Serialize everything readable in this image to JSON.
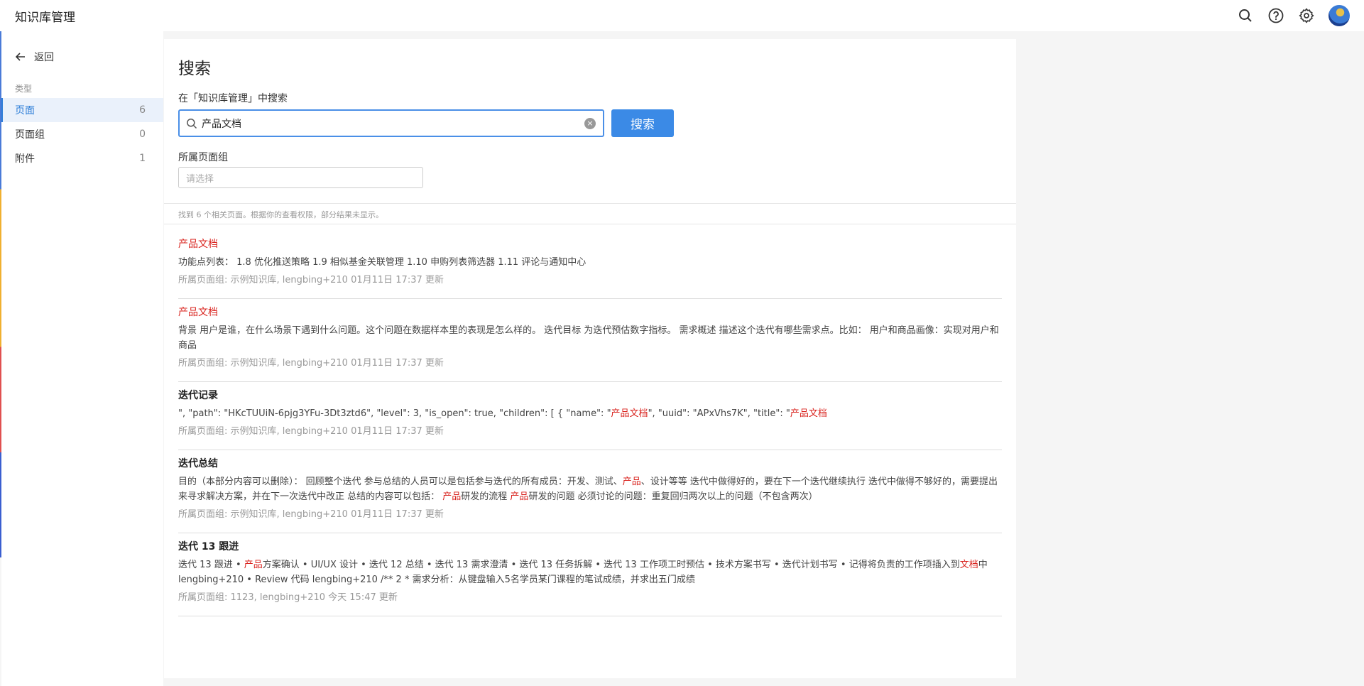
{
  "app": {
    "title": "知识库管理"
  },
  "topbar": {
    "icons": [
      "search-icon",
      "help-icon",
      "settings-icon",
      "avatar"
    ]
  },
  "sidebar": {
    "back_label": "返回",
    "section_label": "类型",
    "items": [
      {
        "label": "页面",
        "count": "6",
        "active": true
      },
      {
        "label": "页面组",
        "count": "0",
        "active": false
      },
      {
        "label": "附件",
        "count": "1",
        "active": false
      }
    ]
  },
  "main": {
    "title": "搜索",
    "scope_label": "在「知识库管理」中搜索",
    "search": {
      "value": "产品文档",
      "placeholder": "",
      "button_label": "搜索"
    },
    "group": {
      "label": "所属页面组",
      "placeholder": "请选择"
    },
    "summary": "找到 6 个相关页面。根据你的查看权限，部分结果未显示。",
    "results": [
      {
        "title": [
          {
            "t": "产品文档",
            "hl": true
          }
        ],
        "title_highlight": true,
        "snippet": [
          {
            "t": "功能点列表：  1.8 优化推送策略 1.9 相似基金关联管理 1.10 申购列表筛选器 1.11 评论与通知中心",
            "hl": false
          }
        ],
        "meta": "所属页面组: 示例知识库, lengbing+210 01月11日 17:37 更新"
      },
      {
        "title": [
          {
            "t": "产品文档",
            "hl": true
          }
        ],
        "title_highlight": true,
        "snippet": [
          {
            "t": "背景 用户是谁，在什么场景下遇到什么问题。这个问题在数据样本里的表现是怎么样的。 迭代目标 为迭代预估数字指标。 需求概述 描述这个迭代有哪些需求点。比如： 用户和商品画像：实现对用户和商品",
            "hl": false
          }
        ],
        "meta": "所属页面组: 示例知识库, lengbing+210 01月11日 17:37 更新"
      },
      {
        "title": [
          {
            "t": "迭代记录",
            "hl": false
          }
        ],
        "title_highlight": false,
        "snippet": [
          {
            "t": "\", \"path\": \"HKcTUUiN-6pjg3YFu-3Dt3ztd6\", \"level\": 3, \"is_open\": true, \"children\": [ { \"name\": \"",
            "hl": false
          },
          {
            "t": "产品文档",
            "hl": true
          },
          {
            "t": "\", \"uuid\": \"APxVhs7K\", \"title\": \"",
            "hl": false
          },
          {
            "t": "产品文档",
            "hl": true
          }
        ],
        "meta": "所属页面组: 示例知识库, lengbing+210 01月11日 17:37 更新"
      },
      {
        "title": [
          {
            "t": "迭代总结",
            "hl": false
          }
        ],
        "title_highlight": false,
        "snippet": [
          {
            "t": "目的（本部分内容可以删除）：  回顾整个迭代 参与总结的人员可以是包括参与迭代的所有成员：开发、测试、",
            "hl": false
          },
          {
            "t": "产品",
            "hl": true
          },
          {
            "t": "、设计等等 迭代中做得好的，要在下一个迭代继续执行 迭代中做得不够好的，需要提出来寻求解决方案，并在下一次迭代中改正   总结的内容可以包括： ",
            "hl": false
          },
          {
            "t": "产品",
            "hl": true
          },
          {
            "t": "研发的流程 ",
            "hl": false
          },
          {
            "t": "产品",
            "hl": true
          },
          {
            "t": "研发的问题 必须讨论的问题：重复回归两次以上的问题（不包含两次）",
            "hl": false
          }
        ],
        "meta": "所属页面组: 示例知识库, lengbing+210 01月11日 17:37 更新"
      },
      {
        "title": [
          {
            "t": "迭代 13 跟进",
            "hl": false
          }
        ],
        "title_highlight": false,
        "snippet": [
          {
            "t": "迭代 13 跟进 • ",
            "hl": false
          },
          {
            "t": "产品",
            "hl": true
          },
          {
            "t": "方案确认 • UI/UX 设计 • 迭代 12 总结 • 迭代 13 需求澄清 • 迭代 13 任务拆解 • 迭代 13 工作项工时预估 • 技术方案书写 • 迭代计划书写 • 记得将负责的工作项插入到",
            "hl": false
          },
          {
            "t": "文档",
            "hl": true
          },
          {
            "t": "中lengbing+210 • Review 代码 lengbing+210 /** 2 * 需求分析：从键盘输入5名学员某门课程的笔试成绩，并求出五门成绩",
            "hl": false
          }
        ],
        "meta": "所属页面组: 1123, lengbing+210 今天 15:47 更新"
      }
    ]
  },
  "colors": {
    "accent": "#3b8ae6",
    "highlight": "#d9231e",
    "active_bg": "#eaf1fb"
  }
}
